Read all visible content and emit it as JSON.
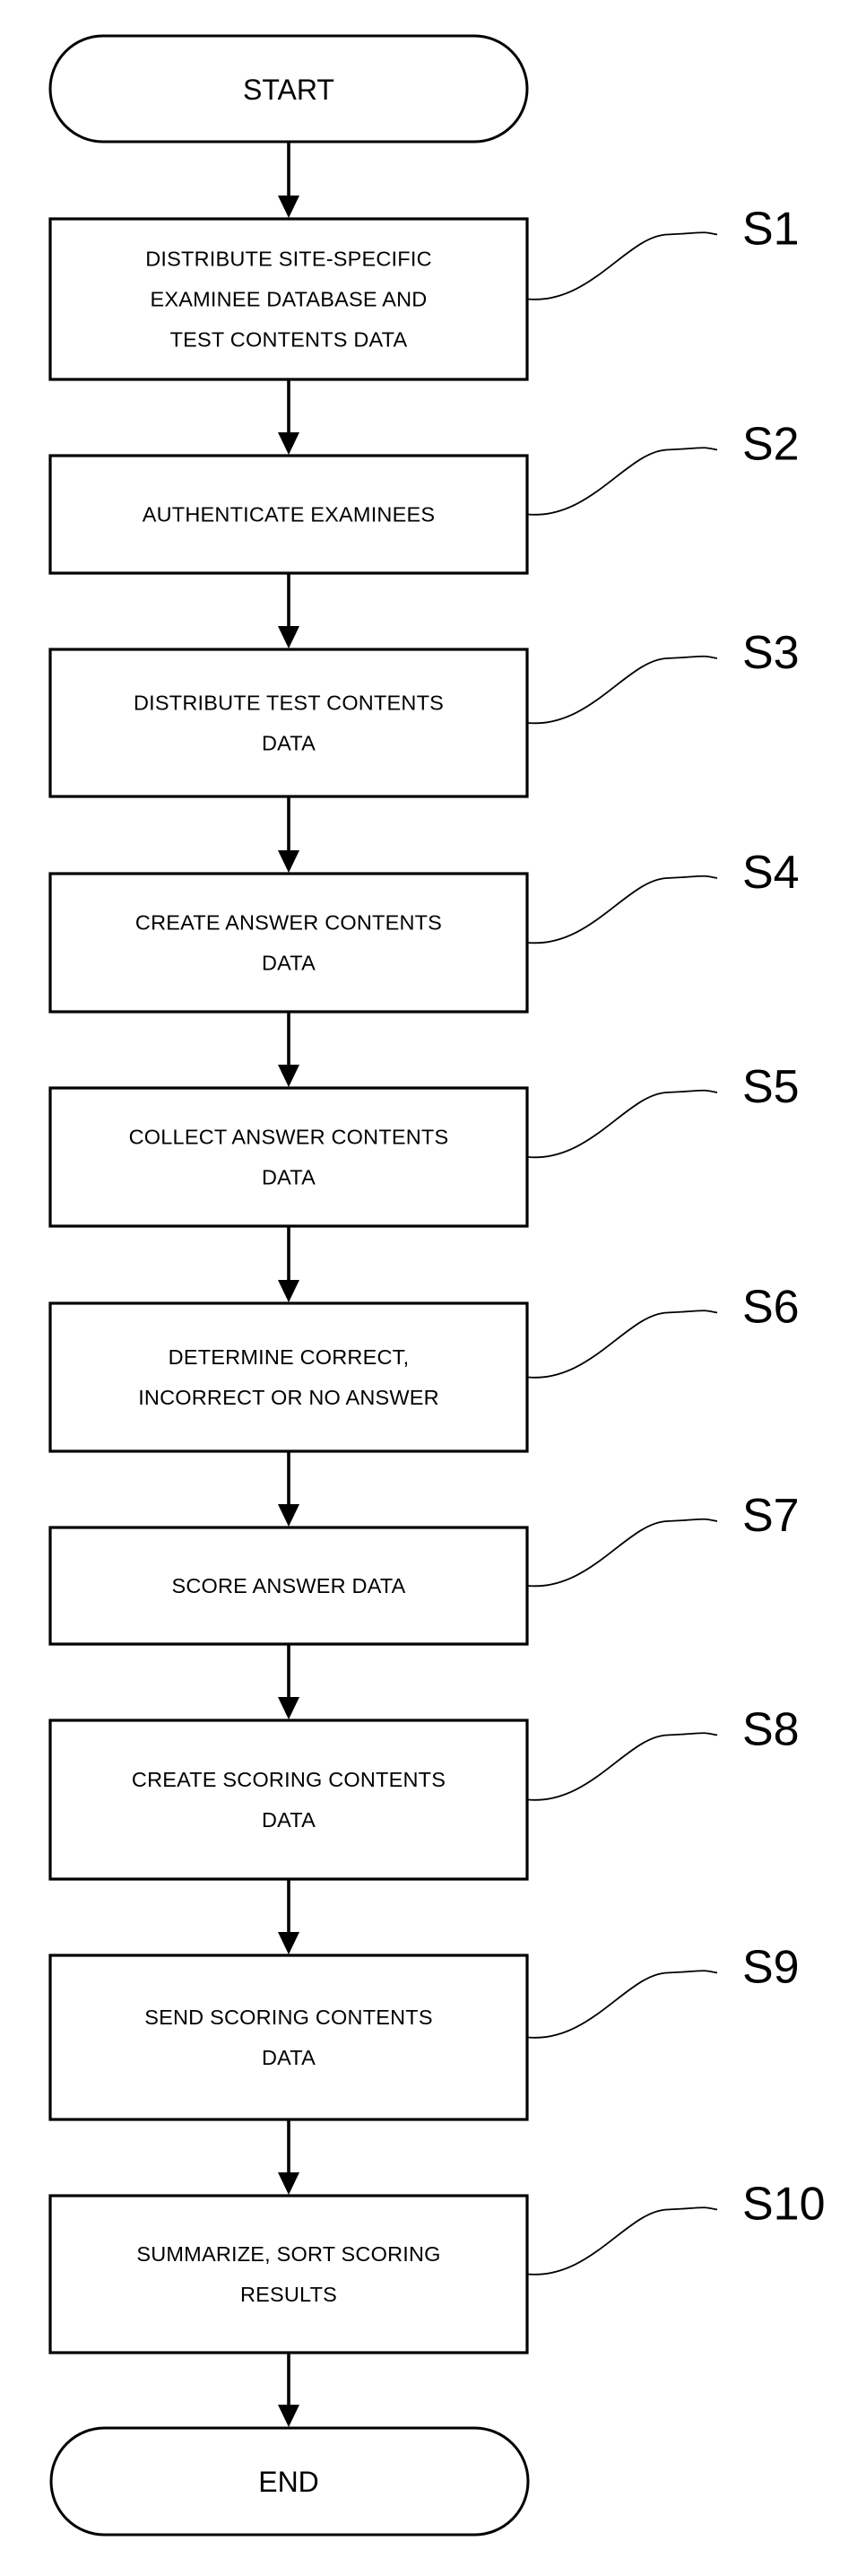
{
  "diagram": {
    "type": "flowchart",
    "colors": {
      "stroke": "#000000",
      "background": "#ffffff",
      "text": "#000000"
    },
    "start": {
      "label": "START"
    },
    "end": {
      "label": "END"
    },
    "steps": [
      {
        "id": "S1",
        "lines": [
          "DISTRIBUTE SITE-SPECIFIC",
          "EXAMINEE DATABASE AND",
          "TEST CONTENTS DATA"
        ]
      },
      {
        "id": "S2",
        "lines": [
          "AUTHENTICATE EXAMINEES"
        ]
      },
      {
        "id": "S3",
        "lines": [
          "DISTRIBUTE TEST CONTENTS",
          "DATA"
        ]
      },
      {
        "id": "S4",
        "lines": [
          "CREATE ANSWER CONTENTS",
          "DATA"
        ]
      },
      {
        "id": "S5",
        "lines": [
          "COLLECT ANSWER CONTENTS",
          "DATA"
        ]
      },
      {
        "id": "S6",
        "lines": [
          "DETERMINE CORRECT,",
          "INCORRECT OR NO ANSWER"
        ]
      },
      {
        "id": "S7",
        "lines": [
          "SCORE ANSWER DATA"
        ]
      },
      {
        "id": "S8",
        "lines": [
          "CREATE SCORING CONTENTS",
          "DATA"
        ]
      },
      {
        "id": "S9",
        "lines": [
          "SEND SCORING CONTENTS",
          "DATA"
        ]
      },
      {
        "id": "S10",
        "lines": [
          "SUMMARIZE, SORT SCORING",
          "RESULTS"
        ]
      }
    ]
  }
}
